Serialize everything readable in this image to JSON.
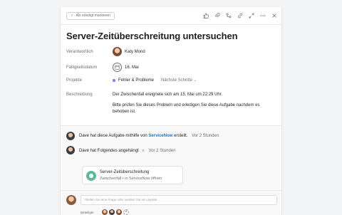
{
  "toolbar": {
    "complete_label": "Als erledigt markieren",
    "icons": [
      "thumbs-up-icon",
      "attach-icon",
      "subtask-icon",
      "link-icon",
      "expand-icon",
      "more-icon",
      "close-icon"
    ]
  },
  "task": {
    "title": "Server-Zeitüberschreitung untersuchen"
  },
  "fields": {
    "assignee_label": "Verantwortlich",
    "assignee_name": "Katy Mond",
    "due_label": "Fälligkeitsdatum",
    "due_value": "16. Mai",
    "projects_label": "Projekte",
    "project_name": "Fehler & Probleme",
    "project_section": "Nächste Schritte",
    "description_label": "Beschreibung",
    "description_p1": "Der Zwischenfall ereignete sich am 15. Mai um 22:29 Uhr.",
    "description_p2": "Bitte prüfen Sie dieses Problem und erledigen Sie diese Aufgabe nachdem es behoben ist."
  },
  "activity": {
    "item1_prefix": "Dave hat diese Aufgabe mithilfe von",
    "item1_link": "ServiceNow",
    "item1_suffix": "erstellt.",
    "item1_time": "Vor 2 Stunden",
    "item2_text": "Dave hat Folgendes angehängt",
    "item2_time": "Vor 2 Stunden",
    "attachment_title": "Server-Zeitüberschreitung",
    "attachment_subtitle": "Zwischenfall • in ServiceNow öffnen"
  },
  "comment": {
    "placeholder": "Stellen Sie eine Frage oder senden Sie ein Update..."
  },
  "collaborators": {
    "label": "Beteiligte"
  },
  "colors": {
    "project_dot": "#8d84e8",
    "link": "#1f76c2",
    "attachment_icon": "#5fb89e"
  }
}
